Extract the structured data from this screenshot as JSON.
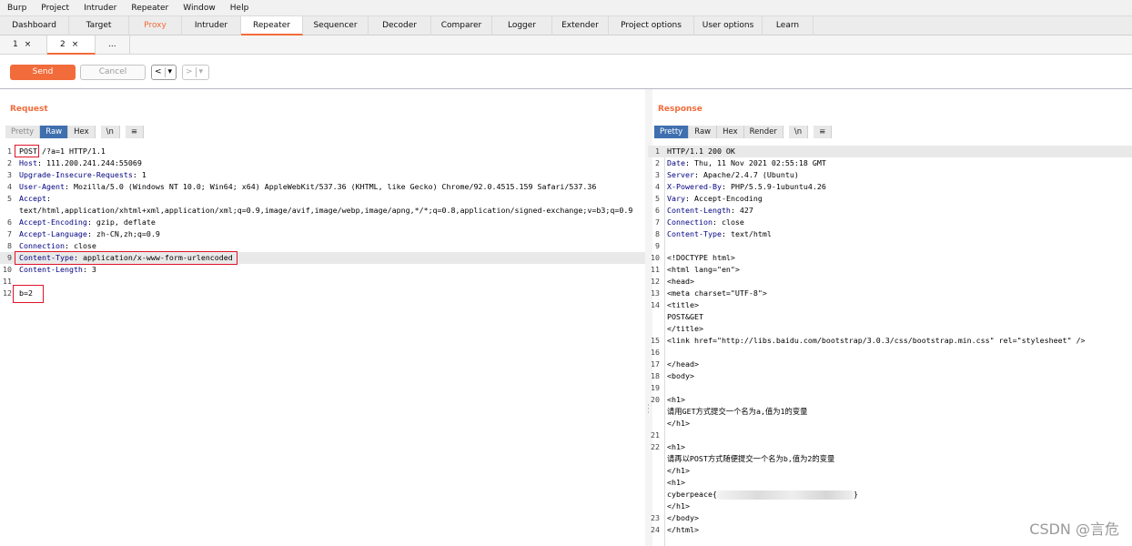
{
  "menu": [
    "Burp",
    "Project",
    "Intruder",
    "Repeater",
    "Window",
    "Help"
  ],
  "tabs": [
    "Dashboard",
    "Target",
    "Proxy",
    "Intruder",
    "Repeater",
    "Sequencer",
    "Decoder",
    "Comparer",
    "Logger",
    "Extender",
    "Project options",
    "User options",
    "Learn"
  ],
  "active_tab": "Repeater",
  "subtabs": {
    "tab1": "1",
    "tab2": "2",
    "more": "...",
    "close": "×"
  },
  "toolbar": {
    "send": "Send",
    "cancel": "Cancel",
    "back": "<",
    "forward": ">",
    "dropdown": "▾"
  },
  "request": {
    "title": "Request",
    "views": {
      "pretty": "Pretty",
      "raw": "Raw",
      "hex": "Hex",
      "newline": "\\n",
      "menu": "≡"
    },
    "active_view": "Raw",
    "lines": [
      {
        "n": "1",
        "text": "POST /?a=1 HTTP/1.1"
      },
      {
        "n": "2",
        "key": "Host",
        "value": " 111.200.241.244:55069"
      },
      {
        "n": "3",
        "key": "Upgrade-Insecure-Requests",
        "value": " 1"
      },
      {
        "n": "4",
        "key": "User-Agent",
        "value": " Mozilla/5.0 (Windows NT 10.0; Win64; x64) AppleWebKit/537.36 (KHTML, like Gecko) Chrome/92.0.4515.159 Safari/537.36"
      },
      {
        "n": "5",
        "key": "Accept",
        "value": ""
      },
      {
        "n": "",
        "text": "text/html,application/xhtml+xml,application/xml;q=0.9,image/avif,image/webp,image/apng,*/*;q=0.8,application/signed-exchange;v=b3;q=0.9"
      },
      {
        "n": "6",
        "key": "Accept-Encoding",
        "value": " gzip, deflate"
      },
      {
        "n": "7",
        "key": "Accept-Language",
        "value": " zh-CN,zh;q=0.9"
      },
      {
        "n": "8",
        "key": "Connection",
        "value": " close"
      },
      {
        "n": "9",
        "key": "Content-Type",
        "value": " application/x-www-form-urlencoded"
      },
      {
        "n": "10",
        "key": "Content-Length",
        "value": " 3"
      },
      {
        "n": "11",
        "text": ""
      },
      {
        "n": "12",
        "text": "b=2"
      }
    ]
  },
  "response": {
    "title": "Response",
    "views": {
      "pretty": "Pretty",
      "raw": "Raw",
      "hex": "Hex",
      "render": "Render",
      "newline": "\\n",
      "menu": "≡"
    },
    "active_view": "Pretty",
    "lines": [
      {
        "n": "1",
        "text": "HTTP/1.1 200 OK"
      },
      {
        "n": "2",
        "key": "Date",
        "value": " Thu, 11 Nov 2021 02:55:18 GMT"
      },
      {
        "n": "3",
        "key": "Server",
        "value": " Apache/2.4.7 (Ubuntu)"
      },
      {
        "n": "4",
        "key": "X-Powered-By",
        "value": " PHP/5.5.9-1ubuntu4.26"
      },
      {
        "n": "5",
        "key": "Vary",
        "value": " Accept-Encoding"
      },
      {
        "n": "6",
        "key": "Content-Length",
        "value": " 427"
      },
      {
        "n": "7",
        "key": "Connection",
        "value": " close"
      },
      {
        "n": "8",
        "key": "Content-Type",
        "value": " text/html"
      },
      {
        "n": "9",
        "text": ""
      },
      {
        "n": "10",
        "text": "<!DOCTYPE html>"
      },
      {
        "n": "11",
        "text": "<html lang=\"en\">"
      },
      {
        "n": "12",
        "text": "  <head>"
      },
      {
        "n": "13",
        "text": "    <meta charset=\"UTF-8\">"
      },
      {
        "n": "14",
        "text": "    <title>"
      },
      {
        "n": "",
        "text": "      POST&GET"
      },
      {
        "n": "",
        "text": "    </title>"
      },
      {
        "n": "15",
        "text": "    <link href=\"http://libs.baidu.com/bootstrap/3.0.3/css/bootstrap.min.css\" rel=\"stylesheet\" />"
      },
      {
        "n": "16",
        "text": ""
      },
      {
        "n": "17",
        "text": "  </head>"
      },
      {
        "n": "18",
        "text": "  <body>"
      },
      {
        "n": "19",
        "text": ""
      },
      {
        "n": "20",
        "text": "    <h1>"
      },
      {
        "n": "",
        "text": "      请用GET方式提交一个名为a,值为1的变量"
      },
      {
        "n": "",
        "text": "    </h1>"
      },
      {
        "n": "21",
        "text": ""
      },
      {
        "n": "22",
        "text": "    <h1>"
      },
      {
        "n": "",
        "text": "      请再以POST方式随便提交一个名为b,值为2的变量"
      },
      {
        "n": "",
        "text": "    </h1>"
      },
      {
        "n": "",
        "text": "    <h1>"
      },
      {
        "n": "",
        "text": "      cyberpeace{",
        "redacted": true,
        "suffix": "}"
      },
      {
        "n": "",
        "text": "    </h1>"
      },
      {
        "n": "23",
        "text": "  </body>"
      },
      {
        "n": "24",
        "text": "</html>"
      }
    ]
  },
  "watermark": "CSDN @言危",
  "colors": {
    "accent": "#f26b3a",
    "active_view": "#3f6fae",
    "highlight_box": "#e0142a"
  }
}
